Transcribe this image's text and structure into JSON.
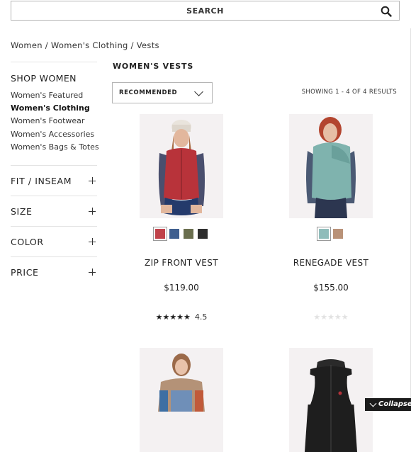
{
  "search": {
    "label": "SEARCH",
    "icon": "search-icon"
  },
  "breadcrumb": {
    "items": [
      "Women",
      "Women's Clothing",
      "Vests"
    ],
    "separator": " / "
  },
  "sidebar": {
    "title": "SHOP WOMEN",
    "links": [
      {
        "label": "Women's Featured",
        "active": false
      },
      {
        "label": "Women's Clothing",
        "active": true
      },
      {
        "label": "Women's Footwear",
        "active": false
      },
      {
        "label": "Women's Accessories",
        "active": false
      },
      {
        "label": "Women's Bags & Totes",
        "active": false
      }
    ],
    "filters": [
      "FIT / INSEAM",
      "SIZE",
      "COLOR",
      "PRICE"
    ]
  },
  "main": {
    "section_title": "WOMEN'S VESTS",
    "sort": {
      "selected": "RECOMMENDED"
    },
    "results_text": "SHOWING 1 - 4 OF 4 RESULTS"
  },
  "products": [
    {
      "name": "ZIP FRONT VEST",
      "price": "$119.00",
      "stars": "★★★★★",
      "rating": "4.5",
      "swatches": [
        "#c0424a",
        "#3f5f8f",
        "#6a6e4e",
        "#2e2e2e"
      ],
      "selected_swatch": 0
    },
    {
      "name": "RENEGADE VEST",
      "price": "$155.00",
      "stars": "★★★★★",
      "rating": "",
      "swatches": [
        "#8fbcba",
        "#b99278"
      ],
      "selected_swatch": 0
    },
    {
      "name": "",
      "price": "",
      "stars": "",
      "rating": "",
      "swatches": []
    },
    {
      "name": "",
      "price": "",
      "stars": "",
      "rating": "",
      "swatches": []
    }
  ],
  "collapse": {
    "label": "Collapse"
  },
  "colors": {
    "border": "#b5b5b5",
    "divider": "#e3e3e3",
    "text": "#222222"
  }
}
